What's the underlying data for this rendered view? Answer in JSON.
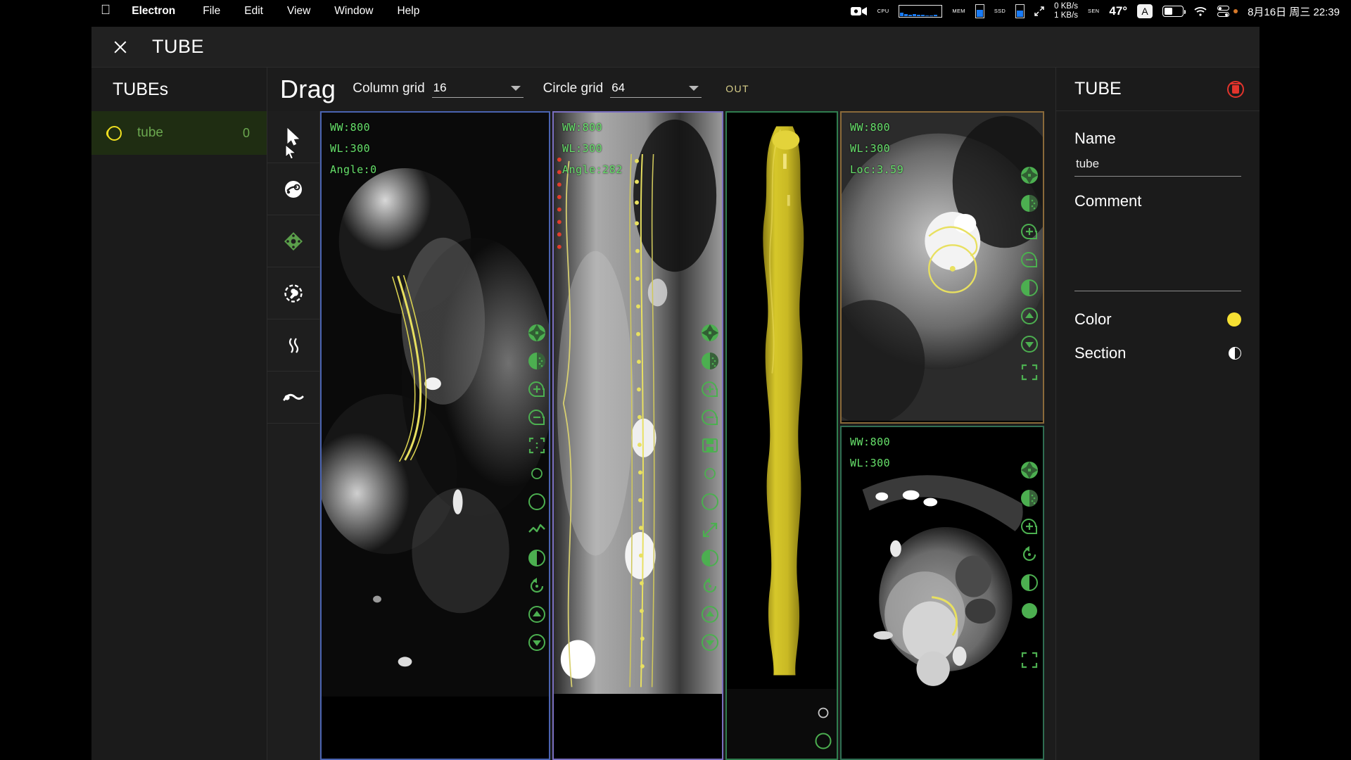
{
  "menubar": {
    "apple_glyph": "&#63743;",
    "items": [
      {
        "label": "Electron",
        "bold": true
      },
      {
        "label": "File",
        "bold": false
      },
      {
        "label": "Edit",
        "bold": false
      },
      {
        "label": "View",
        "bold": false
      },
      {
        "label": "Window",
        "bold": false
      },
      {
        "label": "Help",
        "bold": false
      }
    ],
    "status": {
      "cpu_label": "CPU",
      "mem_label": "MEM",
      "ssd_label": "SSD",
      "net_up": "0 KB/s",
      "net_down": "1 KB/s",
      "sensor_label": "SEN",
      "temperature": "47°",
      "input_source": "A",
      "clock": "8月16日 周三  22:39"
    }
  },
  "window": {
    "title": "TUBE",
    "close_label": "×"
  },
  "sidebar": {
    "header": "TUBEs",
    "items": [
      {
        "name": "tube",
        "count": "0"
      }
    ]
  },
  "toolbar": {
    "mode_label": "Drag",
    "column_grid": {
      "label": "Column grid",
      "value": "16"
    },
    "circle_grid": {
      "label": "Circle grid",
      "value": "64"
    },
    "out_badge": "OUT"
  },
  "tools": [
    {
      "name": "cursor-tool"
    },
    {
      "name": "spray-tool"
    },
    {
      "name": "move-tool"
    },
    {
      "name": "wrench-tool"
    },
    {
      "name": "wave-tool"
    },
    {
      "name": "curve-tool"
    }
  ],
  "viewports": [
    {
      "id": "viewport-mpr-sagittal",
      "overlay": {
        "ww": "WW:800",
        "wl": "WL:300",
        "extra": "Angle:0"
      },
      "border_color": "#4a63b0"
    },
    {
      "id": "viewport-cpr-straight",
      "overlay": {
        "ww": "WW:800",
        "wl": "WL:300",
        "extra": "Angle:282"
      },
      "border_color": "#7a6fc0"
    },
    {
      "id": "viewport-3d-volume",
      "overlay": {
        "ww": "",
        "wl": "",
        "extra": ""
      },
      "border_color": "#2f7d4e"
    },
    {
      "id": "viewport-cross-section",
      "overlay": {
        "ww": "WW:800",
        "wl": "WL:300",
        "extra": "Loc:3.59"
      },
      "border_color": "#8a6a3a"
    },
    {
      "id": "viewport-axial",
      "overlay": {
        "ww": "WW:800",
        "wl": "WL:300",
        "extra": ""
      },
      "border_color": "#2f6e52"
    }
  ],
  "viewport_icons": {
    "vp1": [
      "aperture-icon",
      "contrast-dither-icon",
      "zoom-in-icon",
      "zoom-out-icon",
      "crop-icon",
      "small-circle-icon",
      "large-circle-icon",
      "line-chart-icon",
      "half-contrast-icon",
      "reset-rotate-icon",
      "scroll-up-icon",
      "scroll-down-icon"
    ],
    "vp2": [
      "aperture-icon",
      "contrast-dither-icon",
      "zoom-in-icon",
      "zoom-out-icon",
      "save-icon",
      "small-circle-icon",
      "large-circle-icon",
      "expand-arrows-icon",
      "half-contrast-icon",
      "reset-rotate-icon",
      "scroll-up-icon",
      "scroll-down-icon"
    ],
    "vp3": [
      "small-circle-icon",
      "large-circle-icon"
    ],
    "vp4": [
      "aperture-icon",
      "contrast-dither-icon",
      "zoom-in-icon",
      "zoom-out-icon",
      "half-contrast-icon",
      "scroll-up-icon",
      "scroll-down-icon",
      "fit-screen-icon"
    ],
    "vp5": [
      "aperture-icon",
      "contrast-dither-icon",
      "zoom-in-icon",
      "reset-rotate-icon",
      "half-contrast-icon",
      "filled-circle-icon",
      "fit-screen-icon"
    ]
  },
  "inspector": {
    "title": "TUBE",
    "delete_icon": "trash-icon",
    "name_label": "Name",
    "name_value": "tube",
    "comment_label": "Comment",
    "comment_value": "",
    "comment_placeholder": "",
    "color_label": "Color",
    "color_value": "#f5e033",
    "section_label": "Section"
  }
}
